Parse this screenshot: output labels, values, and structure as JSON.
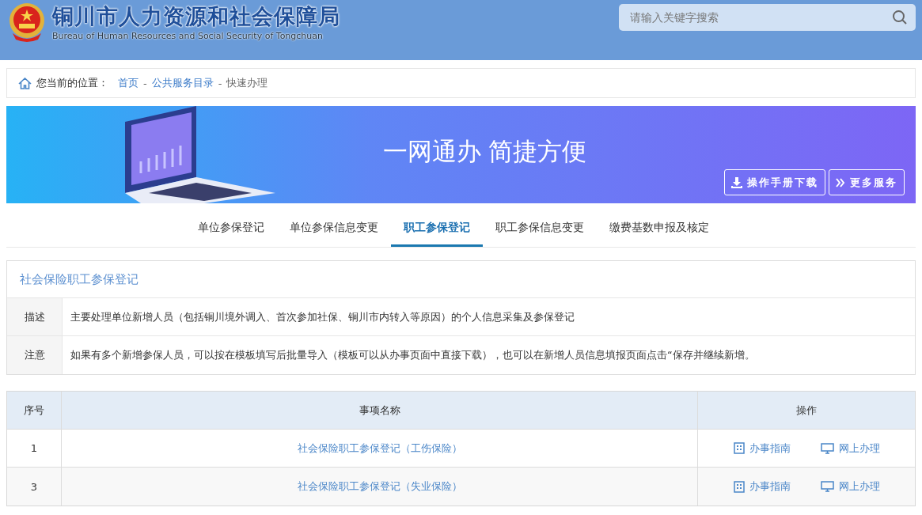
{
  "header": {
    "title": "铜川市人力资源和社会保障局",
    "subtitle": "Bureau of Human Resources and Social Security of Tongchuan",
    "search": {
      "placeholder": "请输入关键字搜索"
    }
  },
  "breadcrumb": {
    "label": "您当前的位置：",
    "items": [
      {
        "text": "首页",
        "kind": "link"
      },
      {
        "text": "-",
        "kind": "sep"
      },
      {
        "text": "公共服务目录",
        "kind": "link"
      },
      {
        "text": "-",
        "kind": "sep"
      },
      {
        "text": "快速办理",
        "kind": "current"
      }
    ]
  },
  "banner": {
    "slogan": "一网通办 简捷方便",
    "buttons": [
      {
        "label": "操作手册下载",
        "kind": "download"
      },
      {
        "label": "更多服务",
        "kind": "more"
      }
    ]
  },
  "tabs": [
    {
      "label": "单位参保登记",
      "selected": false
    },
    {
      "label": "单位参保信息变更",
      "selected": false
    },
    {
      "label": "职工参保登记",
      "selected": true
    },
    {
      "label": "职工参保信息变更",
      "selected": false
    },
    {
      "label": "缴费基数申报及核定",
      "selected": false
    }
  ],
  "info": {
    "title": "社会保险职工参保登记",
    "rows": [
      {
        "label": "描述",
        "text": "主要处理单位新增人员（包括铜川境外调入、首次参加社保、铜川市内转入等原因）的个人信息采集及参保登记"
      },
      {
        "label": "注意",
        "text": "如果有多个新增参保人员，可以按在模板填写后批量导入（模板可以从办事页面中直接下载），也可以在新增人员信息填报页面点击“保存并继续新增。"
      }
    ]
  },
  "table": {
    "columns": [
      "序号",
      "事项名称",
      "操作"
    ],
    "rows": [
      {
        "no": "1",
        "name": "社会保险职工参保登记（工伤保险）",
        "actions": [
          {
            "label": "办事指南",
            "kind": "guide"
          },
          {
            "label": "网上办理",
            "kind": "online"
          }
        ]
      },
      {
        "no": "3",
        "name": "社会保险职工参保登记（失业保险）",
        "actions": [
          {
            "label": "办事指南",
            "kind": "guide"
          },
          {
            "label": "网上办理",
            "kind": "online"
          }
        ]
      }
    ]
  }
}
